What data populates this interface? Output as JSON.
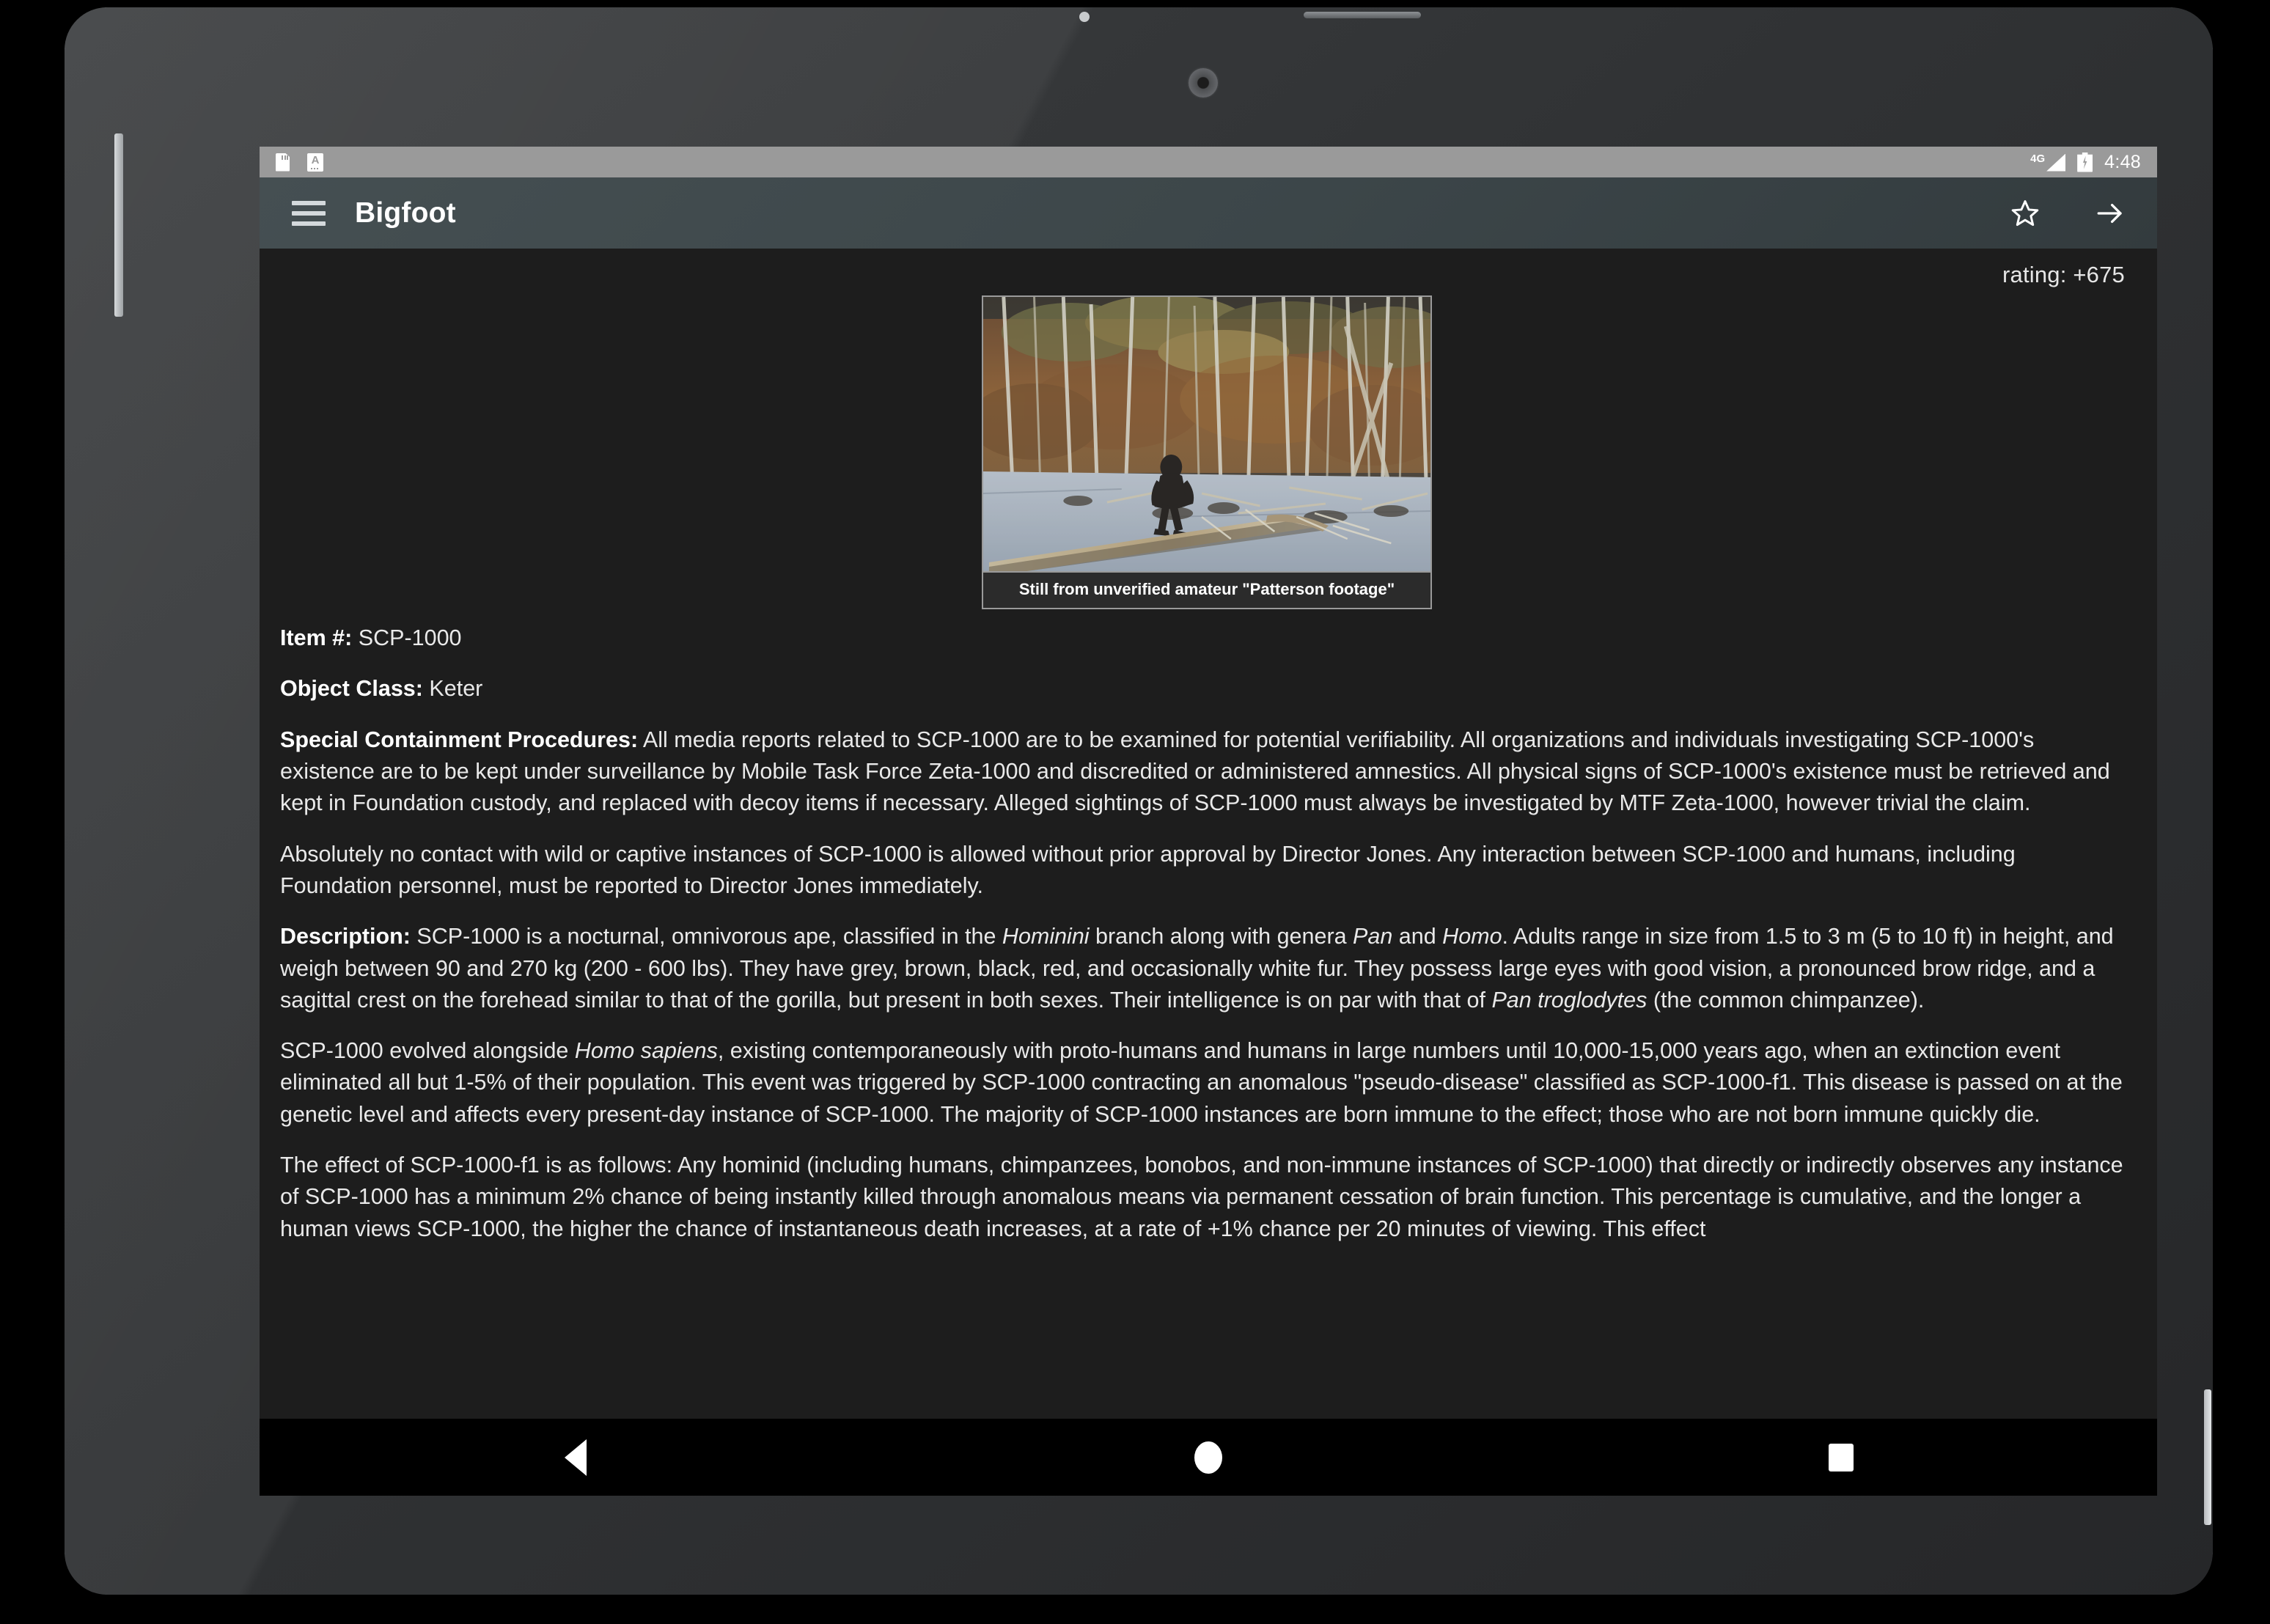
{
  "device": {
    "type": "android-tablet",
    "frame_color": "#cfd2d4"
  },
  "status_bar": {
    "left_icons": [
      "sd-card-icon",
      "text-format-icon"
    ],
    "network_label": "4G",
    "battery_state": "charging",
    "time": "4:48"
  },
  "app_bar": {
    "menu_icon": "hamburger-menu-icon",
    "title": "Bigfoot",
    "actions": [
      {
        "icon": "star-outline-icon",
        "name": "favorite-button"
      },
      {
        "icon": "arrow-right-icon",
        "name": "forward-button"
      }
    ]
  },
  "article": {
    "rating": "rating: +675",
    "figure": {
      "caption": "Still from unverified amateur \"Patterson footage\"",
      "alt": "Blurry forest photograph showing a dark bipedal figure walking past fallen logs"
    },
    "fields": [
      {
        "label": "Item #:",
        "value": " SCP-1000"
      },
      {
        "label": "Object Class:",
        "value": " Keter"
      }
    ],
    "paragraphs": [
      {
        "label": "Special Containment Procedures:",
        "text": " All media reports related to SCP-1000 are to be examined for potential verifiability. All organizations and individuals investigating SCP-1000's existence are to be kept under surveillance by Mobile Task Force Zeta-1000 and discredited or administered amnestics. All physical signs of SCP-1000's existence must be retrieved and kept in Foundation custody, and replaced with decoy items if necessary. Alleged sightings of SCP-1000 must always be investigated by MTF Zeta-1000, however trivial the claim."
      },
      {
        "label": "",
        "text": "Absolutely no contact with wild or captive instances of SCP-1000 is allowed without prior approval by Director Jones. Any interaction between SCP-1000 and humans, including Foundation personnel, must be reported to Director Jones immediately."
      }
    ],
    "description_label": "Description:",
    "description_html": " SCP-1000 is a nocturnal, omnivorous ape, classified in the <i>Hominini</i> branch along with genera <i>Pan</i> and <i>Homo</i>. Adults range in size from 1.5 to 3 m (5 to 10 ft) in height, and weigh between 90 and 270 kg (200 - 600 lbs). They have grey, brown, black, red, and occasionally white fur. They possess large eyes with good vision, a pronounced brow ridge, and a sagittal crest on the forehead similar to that of the gorilla, but present in both sexes. Their intelligence is on par with that of <i>Pan troglodytes</i> (the common chimpanzee).",
    "evolution_html": "SCP-1000 evolved alongside <i>Homo sapiens</i>, existing contemporaneously with proto-humans and humans in large numbers until 10,000-15,000 years ago, when an extinction event eliminated all but 1-5% of their population. This event was triggered by SCP-1000 contracting an anomalous \"pseudo-disease\" classified as SCP-1000-f1. This disease is passed on at the genetic level and affects every present-day instance of SCP-1000. The majority of SCP-1000 instances are born immune to the effect; those who are not born immune quickly die.",
    "effect_html": "The effect of SCP-1000-f1 is as follows: Any hominid (including humans, chimpanzees, bonobos, and non-immune instances of SCP-1000) that directly or indirectly observes any instance of SCP-1000 has a minimum 2% chance of being instantly killed through anomalous means via permanent cessation of brain function. This percentage is cumulative, and the longer a human views SCP-1000, the higher the chance of instantaneous death increases, at a rate of +1% chance per 20 minutes of viewing. This effect"
  },
  "nav_bar": {
    "buttons": [
      {
        "name": "back-button",
        "icon": "triangle-back-icon"
      },
      {
        "name": "home-button",
        "icon": "circle-home-icon"
      },
      {
        "name": "recents-button",
        "icon": "square-recents-icon"
      }
    ]
  }
}
